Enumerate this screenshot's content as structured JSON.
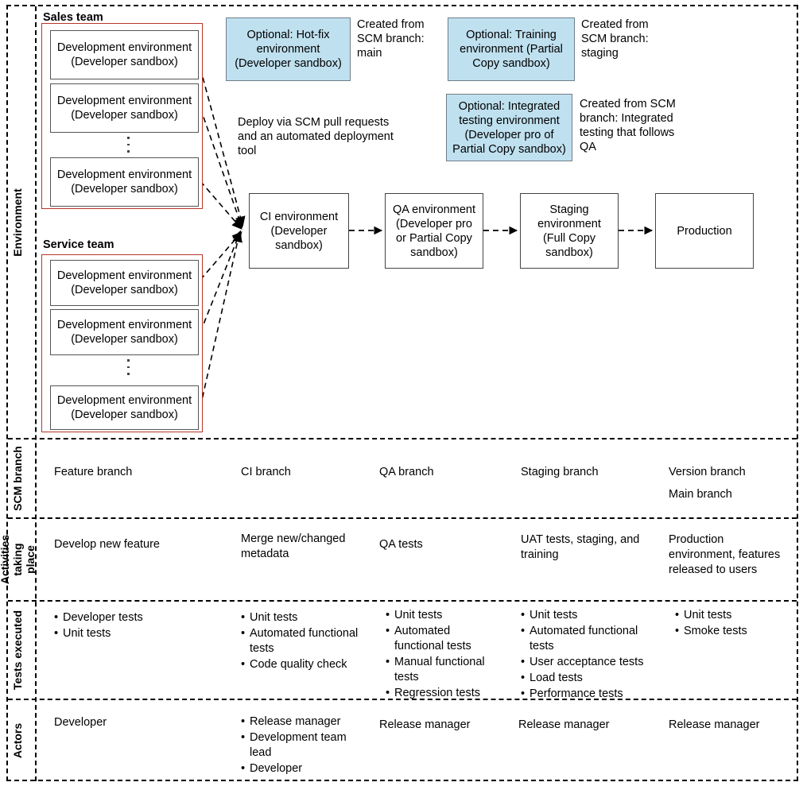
{
  "rows": [
    {
      "key": "environment",
      "label": "Environment"
    },
    {
      "key": "scm",
      "label": "SCM branch"
    },
    {
      "key": "activities",
      "label": "Activities taking place"
    },
    {
      "key": "tests",
      "label": "Tests executed"
    },
    {
      "key": "actors",
      "label": "Actors"
    }
  ],
  "environment": {
    "teams": [
      {
        "title": "Sales team",
        "boxes": [
          "Development environment (Developer sandbox)",
          "Development environment (Developer sandbox)",
          "Development environment (Developer sandbox)"
        ]
      },
      {
        "title": "Service team",
        "boxes": [
          "Development environment (Developer sandbox)",
          "Development environment (Developer sandbox)",
          "Development environment (Developer sandbox)"
        ]
      }
    ],
    "dev_box_line1": "Development environment",
    "dev_box_line2": "(Developer sandbox)",
    "optional_boxes": [
      {
        "name": "hotfix",
        "line1": "Optional: Hot-fix",
        "line2": "environment",
        "line3": "(Developer sandbox)",
        "note": "Created from SCM branch: main"
      },
      {
        "name": "training",
        "line1": "Optional: Training",
        "line2": "environment (Partial",
        "line3": "Copy sandbox)",
        "note": "Created from SCM branch: staging"
      },
      {
        "name": "integrated-testing",
        "line1": "Optional: Integrated",
        "line2": "testing environment",
        "line3": "(Developer pro of",
        "line4": "Partial Copy sandbox)",
        "note": "Created from SCM branch: Integrated testing that follows QA"
      }
    ],
    "deploy_note": "Deploy via SCM pull requests and an automated deployment tool",
    "pipeline": [
      {
        "name": "ci",
        "line1": "CI environment",
        "line2": "(Developer",
        "line3": "sandbox)"
      },
      {
        "name": "qa",
        "line1": "QA environment",
        "line2": "(Developer pro",
        "line3": "or Partial Copy",
        "line4": "sandbox)"
      },
      {
        "name": "staging",
        "line1": "Staging",
        "line2": "environment",
        "line3": "(Full Copy",
        "line4": "sandbox)"
      },
      {
        "name": "production",
        "line1": "Production"
      }
    ]
  },
  "scm": {
    "columns": [
      {
        "lines": [
          "Feature branch"
        ]
      },
      {
        "lines": [
          "CI branch"
        ]
      },
      {
        "lines": [
          "QA branch"
        ]
      },
      {
        "lines": [
          "Staging branch"
        ]
      },
      {
        "lines": [
          "Version branch",
          "Main branch"
        ]
      }
    ]
  },
  "activities": {
    "columns": [
      {
        "text": "Develop new feature"
      },
      {
        "text": "Merge new/changed metadata"
      },
      {
        "text": "QA tests"
      },
      {
        "text": "UAT tests, staging, and training"
      },
      {
        "text": "Production environment, features released to users"
      }
    ]
  },
  "tests": {
    "columns": [
      {
        "items": [
          "Developer tests",
          "Unit tests"
        ]
      },
      {
        "items": [
          "Unit tests",
          "Automated functional tests",
          "Code quality check"
        ]
      },
      {
        "items": [
          "Unit tests",
          "Automated functional tests",
          "Manual functional tests",
          "Regression tests"
        ]
      },
      {
        "items": [
          "Unit tests",
          "Automated functional tests",
          "User acceptance tests",
          "Load tests",
          "Performance tests"
        ]
      },
      {
        "items": [
          "Unit tests",
          "Smoke tests"
        ]
      }
    ]
  },
  "actors": {
    "columns": [
      {
        "plain": "Developer",
        "items": []
      },
      {
        "plain": "",
        "items": [
          "Release manager",
          "Development team lead",
          "Developer"
        ]
      },
      {
        "plain": "Release manager",
        "items": []
      },
      {
        "plain": "Release manager",
        "items": []
      },
      {
        "plain": "Release manager",
        "items": []
      }
    ]
  },
  "colors": {
    "optional_fill": "#bfe0ef",
    "team_border": "#b5372a",
    "box_border": "#555555",
    "frame": "#000000"
  }
}
